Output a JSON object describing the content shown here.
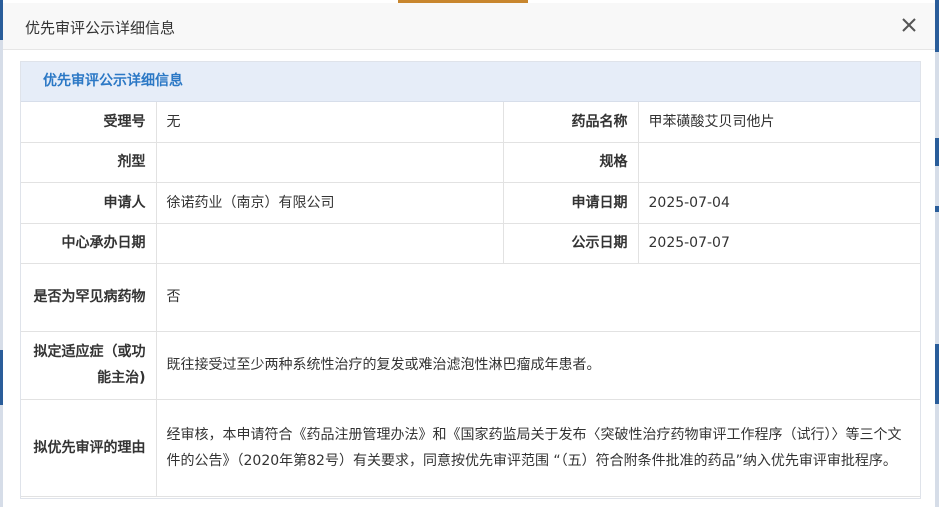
{
  "dialog": {
    "title": "优先审评公示详细信息",
    "close_icon": "close-icon"
  },
  "panel": {
    "heading": "优先审评公示详细信息"
  },
  "fields": {
    "acceptance_no_label": "受理号",
    "acceptance_no": "无",
    "drug_name_label": "药品名称",
    "drug_name": "甲苯磺酸艾贝司他片",
    "dosage_form_label": "剂型",
    "dosage_form": "",
    "specification_label": "规格",
    "specification": "",
    "applicant_label": "申请人",
    "applicant": "徐诺药业（南京）有限公司",
    "apply_date_label": "申请日期",
    "apply_date": "2025-07-04",
    "center_date_label": "中心承办日期",
    "center_date": "",
    "publish_date_label": "公示日期",
    "publish_date": "2025-07-07",
    "rare_disease_label": "是否为罕见病药物",
    "rare_disease": "否",
    "indication_label": "拟定适应症（或功能主治)",
    "indication": "既往接受过至少两种系统性治疗的复发或难治滤泡性淋巴瘤成年患者。",
    "reason_label": "拟优先审评的理由",
    "reason": "经审核，本申请符合《药品注册管理办法》和《国家药监局关于发布〈突破性治疗药物审评工作程序（试行）〉等三个文件的公告》（2020年第82号）有关要求，同意按优先审评范围 “（五）符合附条件批准的药品”纳入优先审评审批程序。"
  },
  "colors": {
    "heading_bg": "#e6edf8",
    "heading_text": "#2b78c5",
    "border": "#e2e2e2"
  }
}
